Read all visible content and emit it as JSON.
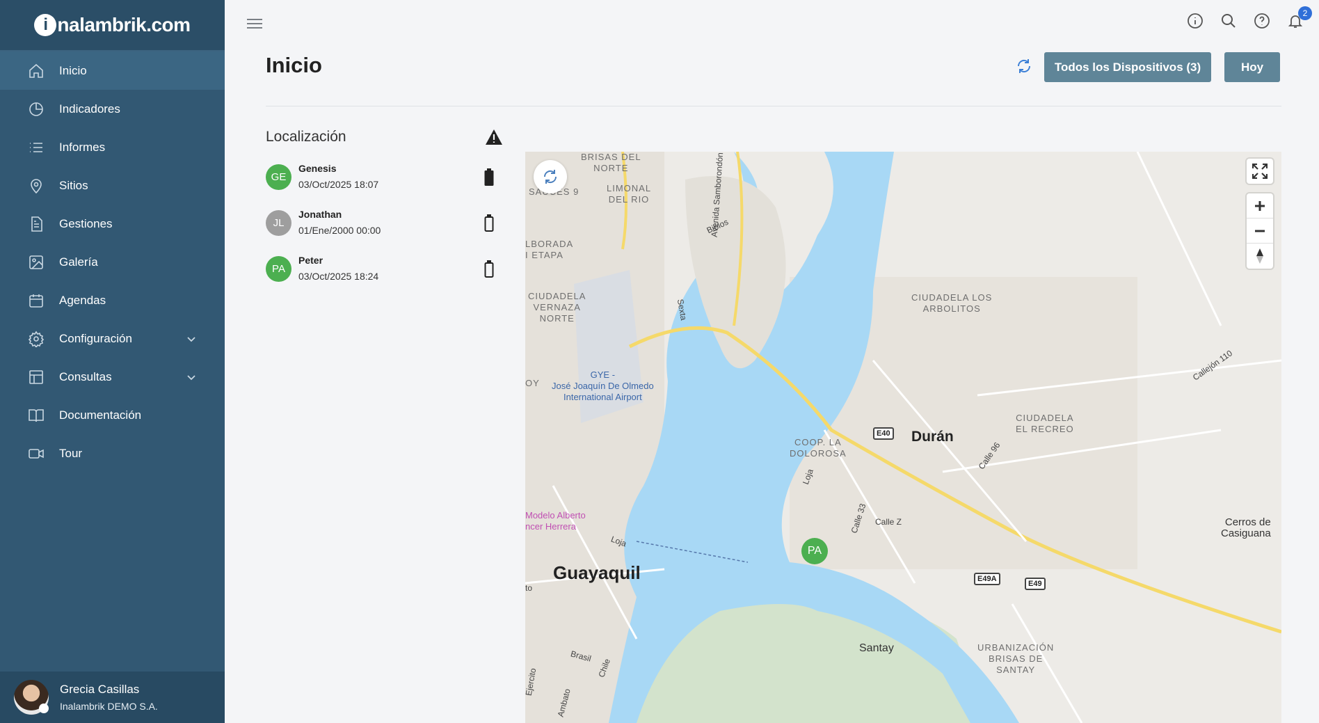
{
  "app": {
    "logo_text": "nalambrik.com",
    "logo_initial": "i"
  },
  "sidebar": {
    "items": [
      {
        "label": "Inicio",
        "icon": "home-icon"
      },
      {
        "label": "Indicadores",
        "icon": "pie-chart-icon"
      },
      {
        "label": "Informes",
        "icon": "list-icon"
      },
      {
        "label": "Sitios",
        "icon": "map-pin-icon"
      },
      {
        "label": "Gestiones",
        "icon": "document-icon"
      },
      {
        "label": "Galería",
        "icon": "image-icon"
      },
      {
        "label": "Agendas",
        "icon": "calendar-icon"
      },
      {
        "label": "Configuración",
        "icon": "gear-icon"
      },
      {
        "label": "Consultas",
        "icon": "table-icon"
      },
      {
        "label": "Documentación",
        "icon": "book-icon"
      },
      {
        "label": "Tour",
        "icon": "video-icon"
      }
    ],
    "user": {
      "name": "Grecia Casillas",
      "company": "Inalambrik DEMO S.A."
    }
  },
  "header": {
    "notifications_count": "2",
    "title": "Inicio",
    "devices_button": "Todos los Dispositivos (3)",
    "today_button": "Hoy"
  },
  "location": {
    "title": "Localización",
    "devices": [
      {
        "initials": "GE",
        "name": "Genesis",
        "date": "03/Oct/2025 18:07",
        "color": "#4caf50",
        "battery": "full"
      },
      {
        "initials": "JL",
        "name": "Jonathan",
        "date": "01/Ene/2000 00:00",
        "color": "#9e9e9e",
        "battery": "empty"
      },
      {
        "initials": "PA",
        "name": "Peter",
        "date": "03/Oct/2025 18:24",
        "color": "#4caf50",
        "battery": "empty"
      }
    ]
  },
  "map": {
    "labels": {
      "brisas": "BRISAS DEL\nNORTE",
      "sauces": "SAUCES 9",
      "limonal": "LIMONAL\nDEL RIO",
      "borada": "LBORADA\nI ETAPA",
      "vernaza": "CIUDADELA\nVERNAZA\nNORTE",
      "airport": "GYE -\nJosé Joaquín De Olmedo\nInternational Airport",
      "arbolitos": "CIUDADELA LOS\nARBOLITOS",
      "recreo": "CIUDADELA\nEL RECREO",
      "dolorosa": "COOP. LA\nDOLOROSA",
      "brisas_santay": "URBANIZACIÓN\nBRISAS DE\nSANTAY",
      "cerros": "Cerros de\nCasiguana",
      "modelo": "Modelo Alberto\nncer Herrera",
      "oy": "OY"
    },
    "cities": {
      "guayaquil": "Guayaquil",
      "duran": "Durán",
      "santay": "Santay"
    },
    "roads": {
      "samborondon": "Avenida Samborondón",
      "biblos": "Biblos",
      "sexta": "Sexta",
      "loja": "Loja",
      "loja2": "Loja",
      "calle33": "Calle 33",
      "callez": "Calle Z",
      "calle96": "Calle 96",
      "callejon": "Callejón 110",
      "brasil": "Brasil",
      "chile": "Chile",
      "ambato": "Ambato",
      "ejercito": "Ejercito",
      "to": "to"
    },
    "shields": {
      "e40": "E40",
      "e49a": "E49A",
      "e49": "E49"
    },
    "pin": "PA"
  }
}
